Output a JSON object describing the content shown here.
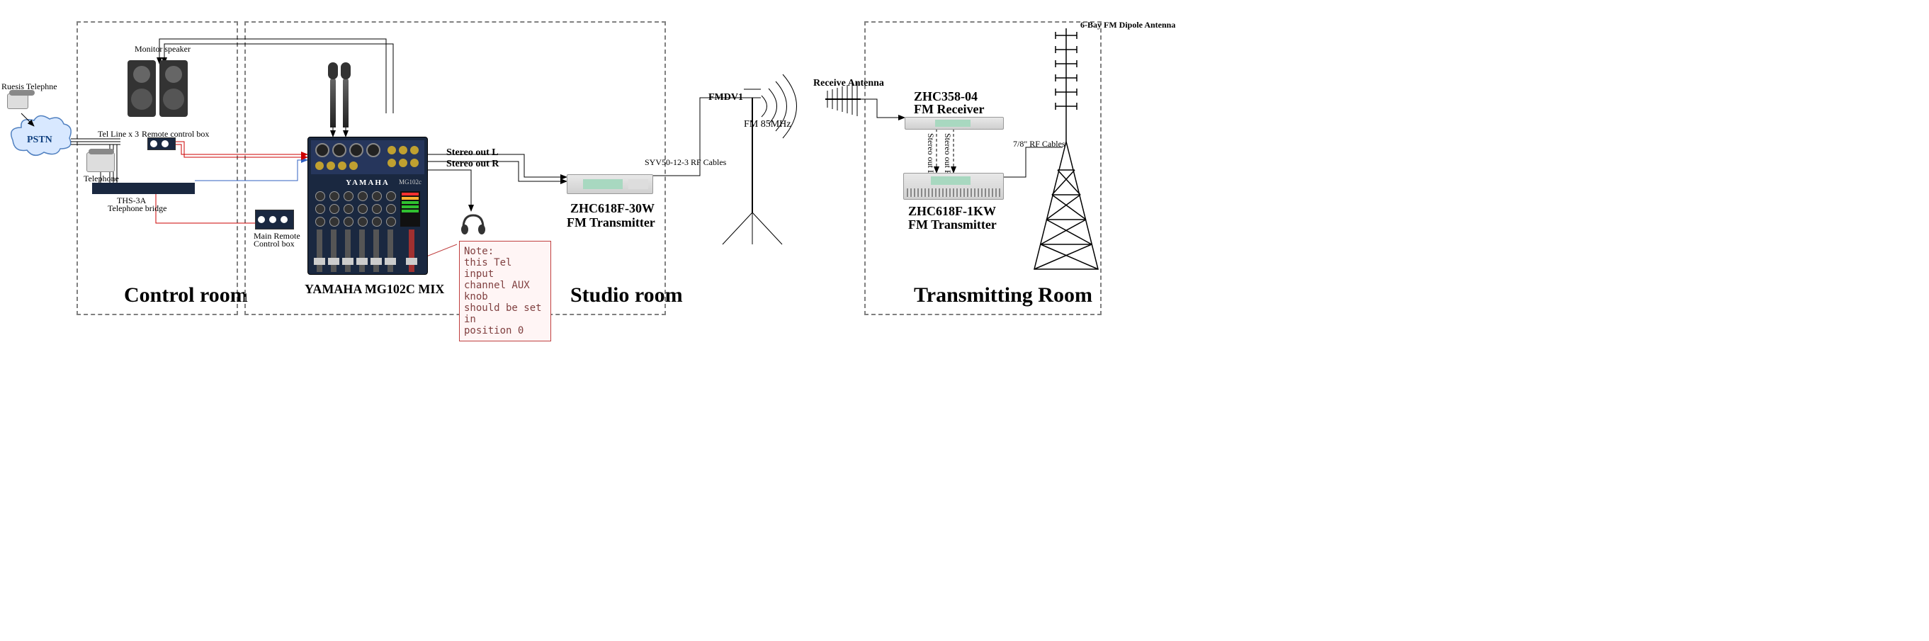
{
  "rooms": {
    "control": "Control  room",
    "studio": "Studio room",
    "transmitting": "Transmitting Room"
  },
  "labels": {
    "ruesis": "Ruesis Telephne",
    "pstn": "PSTN",
    "tel_line": "Tel Line x 3",
    "telephone": "Telephone",
    "remote_box": "Remote control box",
    "ths3a_1": "THS-3A",
    "ths3a_2": "Telephone bridge",
    "main_remote_1": "Main Remote",
    "main_remote_2": "Control box",
    "monitor_speaker": "Monitor speaker",
    "mixer": "YAMAHA MG102C MIX",
    "yamaha_logo": "YAMAHA",
    "mixer_model": "MG102c",
    "stereo_l": "Stereo out  L",
    "stereo_r": "Stereo out  R",
    "tx30_1": "ZHC618F-30W",
    "tx30_2": "FM  Transmitter",
    "fmdv1": "FMDV1",
    "fm85": "FM 85MHz",
    "rf_cable_1": "SYV50-12-3 RF Cables",
    "rx_ant": "Receive Antenna",
    "receiver_1": "ZHC358-04",
    "receiver_2": "FM Receiver",
    "stereo_out_l_v": "Stereo out  L",
    "stereo_out_r_v": "Stereo out  R",
    "tx1kw_1": "ZHC618F-1KW",
    "tx1kw_2": "FM Transmitter",
    "rf_cable_2": "7/8\" RF Cables",
    "dipole": "6-Bay FM Dipole Antenna"
  },
  "note": {
    "title": "Note:",
    "l1": "this Tel input",
    "l2": "channel AUX knob",
    "l3": "should be set in",
    "l4": "position 0"
  }
}
